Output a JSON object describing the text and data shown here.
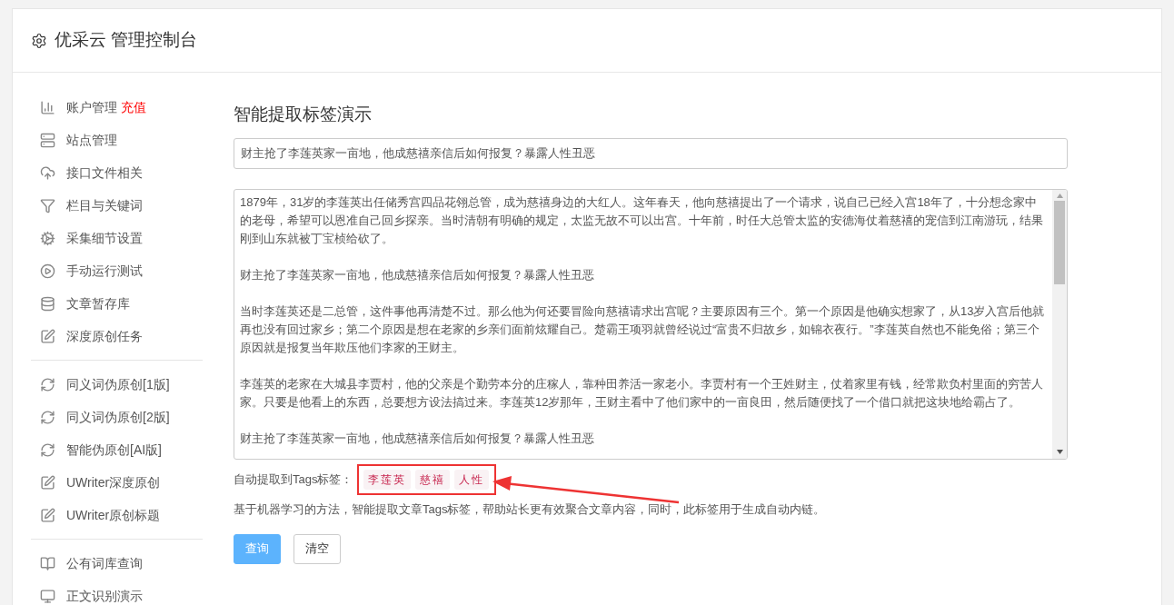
{
  "header": {
    "title": "优采云 管理控制台"
  },
  "sidebar": {
    "groups": [
      [
        {
          "label": "账户管理",
          "badge": "充值"
        },
        {
          "label": "站点管理"
        },
        {
          "label": "接口文件相关"
        },
        {
          "label": "栏目与关键词"
        },
        {
          "label": "采集细节设置"
        },
        {
          "label": "手动运行测试"
        },
        {
          "label": "文章暂存库"
        },
        {
          "label": "深度原创任务"
        }
      ],
      [
        {
          "label": "同义词伪原创[1版]"
        },
        {
          "label": "同义词伪原创[2版]"
        },
        {
          "label": "智能伪原创[AI版]"
        },
        {
          "label": "UWriter深度原创"
        },
        {
          "label": "UWriter原创标题"
        }
      ],
      [
        {
          "label": "公有词库查询"
        },
        {
          "label": "正文识别演示"
        }
      ]
    ]
  },
  "main": {
    "title": "智能提取标签演示",
    "title_field": {
      "value": "财主抢了李莲英家一亩地，他成慈禧亲信后如何报复？暴露人性丑恶"
    },
    "content_field": {
      "paragraphs": [
        "1879年，31岁的李莲英出任储秀宫四品花翎总管，成为慈禧身边的大红人。这年春天，他向慈禧提出了一个请求，说自己已经入宫18年了，十分想念家中的老母，希望可以恩准自己回乡探亲。当时清朝有明确的规定，太监无故不可以出宫。十年前，时任大总管太监的安德海仗着慈禧的宠信到江南游玩，结果刚到山东就被丁宝桢给砍了。",
        "财主抢了李莲英家一亩地，他成慈禧亲信后如何报复？暴露人性丑恶",
        "当时李莲英还是二总管，这件事他再清楚不过。那么他为何还要冒险向慈禧请求出宫呢？主要原因有三个。第一个原因是他确实想家了，从13岁入宫后他就再也没有回过家乡；第二个原因是想在老家的乡亲们面前炫耀自己。楚霸王项羽就曾经说过“富贵不归故乡，如锦衣夜行。”李莲英自然也不能免俗；第三个原因就是报复当年欺压他们李家的王财主。",
        "李莲英的老家在大城县李贾村，他的父亲是个勤劳本分的庄稼人，靠种田养活一家老小。李贾村有一个王姓财主，仗着家里有钱，经常欺负村里面的穷苦人家。只要是他看上的东西，总要想方设法搞过来。李莲英12岁那年，王财主看中了他们家中的一亩良田，然后随便找了一个借口就把这块地给霸占了。",
        "财主抢了李莲英家一亩地，他成慈禧亲信后如何报复？暴露人性丑恶"
      ]
    },
    "tags_label": "自动提取到Tags标签：",
    "tags": [
      "李莲英",
      "慈禧",
      "人性"
    ],
    "description": "基于机器学习的方法，智能提取文章Tags标签，帮助站长更有效聚合文章内容，同时，此标签用于生成自动内链。",
    "buttons": [
      {
        "label": "查询",
        "kind": "primary"
      },
      {
        "label": "清空",
        "kind": "default"
      }
    ]
  }
}
